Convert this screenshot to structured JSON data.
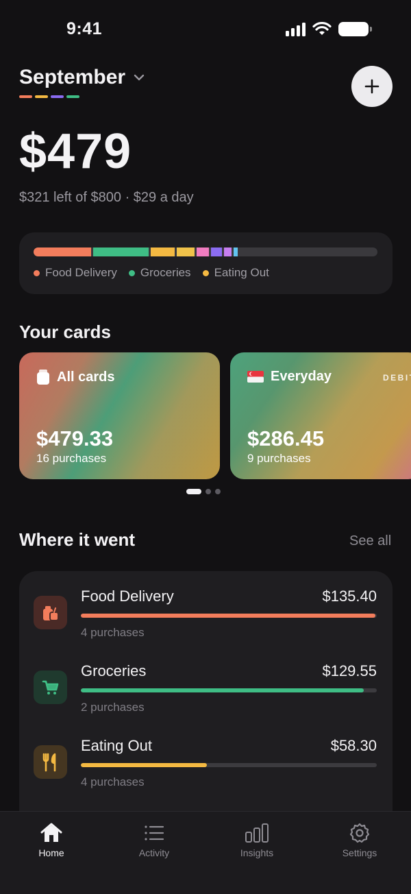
{
  "status": {
    "time": "9:41"
  },
  "header": {
    "month": "September",
    "month_dot_colors": [
      "#f37d5c",
      "#f4b942",
      "#8b6cf2",
      "#3fbd85"
    ],
    "total": "$479",
    "subtitle": "$321 left of $800 · $29 a day"
  },
  "budget": {
    "spent_fraction": 0.6,
    "segments": [
      {
        "color": "#f37d5c",
        "value": 135.4
      },
      {
        "color": "#3fbd85",
        "value": 129.55
      },
      {
        "color": "#f4b942",
        "value": 58.3
      },
      {
        "color": "#f0c24a",
        "value": 45
      },
      {
        "color": "#f07cc0",
        "value": 32
      },
      {
        "color": "#8b6cf2",
        "value": 30
      },
      {
        "color": "#c77ef0",
        "value": 22
      },
      {
        "color": "#62c4f0",
        "value": 14
      }
    ],
    "legend": [
      {
        "label": "Food Delivery",
        "color": "#f37d5c"
      },
      {
        "label": "Groceries",
        "color": "#3fbd85"
      },
      {
        "label": "Eating Out",
        "color": "#f4b942"
      }
    ]
  },
  "cards_section": {
    "title": "Your cards",
    "cards": [
      {
        "name": "All cards",
        "amount": "$479.33",
        "count": "16 purchases"
      },
      {
        "name": "Everyday",
        "flag": "🇸🇬",
        "amount": "$286.45",
        "count": "9 purchases",
        "tag": "DEBIT"
      }
    ]
  },
  "where": {
    "title": "Where it went",
    "see_all": "See all",
    "items": [
      {
        "name": "Food Delivery",
        "amount": "$135.40",
        "count": "4 purchases",
        "progress": 0.995,
        "color": "#f37d5c",
        "icon_bg": "#4a2a26",
        "icon": "bag-icon"
      },
      {
        "name": "Groceries",
        "amount": "$129.55",
        "count": "2 purchases",
        "progress": 0.955,
        "color": "#3fbd85",
        "icon_bg": "#1f3a2e",
        "icon": "cart-icon"
      },
      {
        "name": "Eating Out",
        "amount": "$58.30",
        "count": "4 purchases",
        "progress": 0.425,
        "color": "#f4b942",
        "icon_bg": "#453621",
        "icon": "utensils-icon"
      }
    ]
  },
  "tabs": [
    {
      "label": "Home",
      "icon": "home-icon",
      "active": true
    },
    {
      "label": "Activity",
      "icon": "list-icon",
      "active": false
    },
    {
      "label": "Insights",
      "icon": "bars-icon",
      "active": false
    },
    {
      "label": "Settings",
      "icon": "gear-icon",
      "active": false
    }
  ]
}
